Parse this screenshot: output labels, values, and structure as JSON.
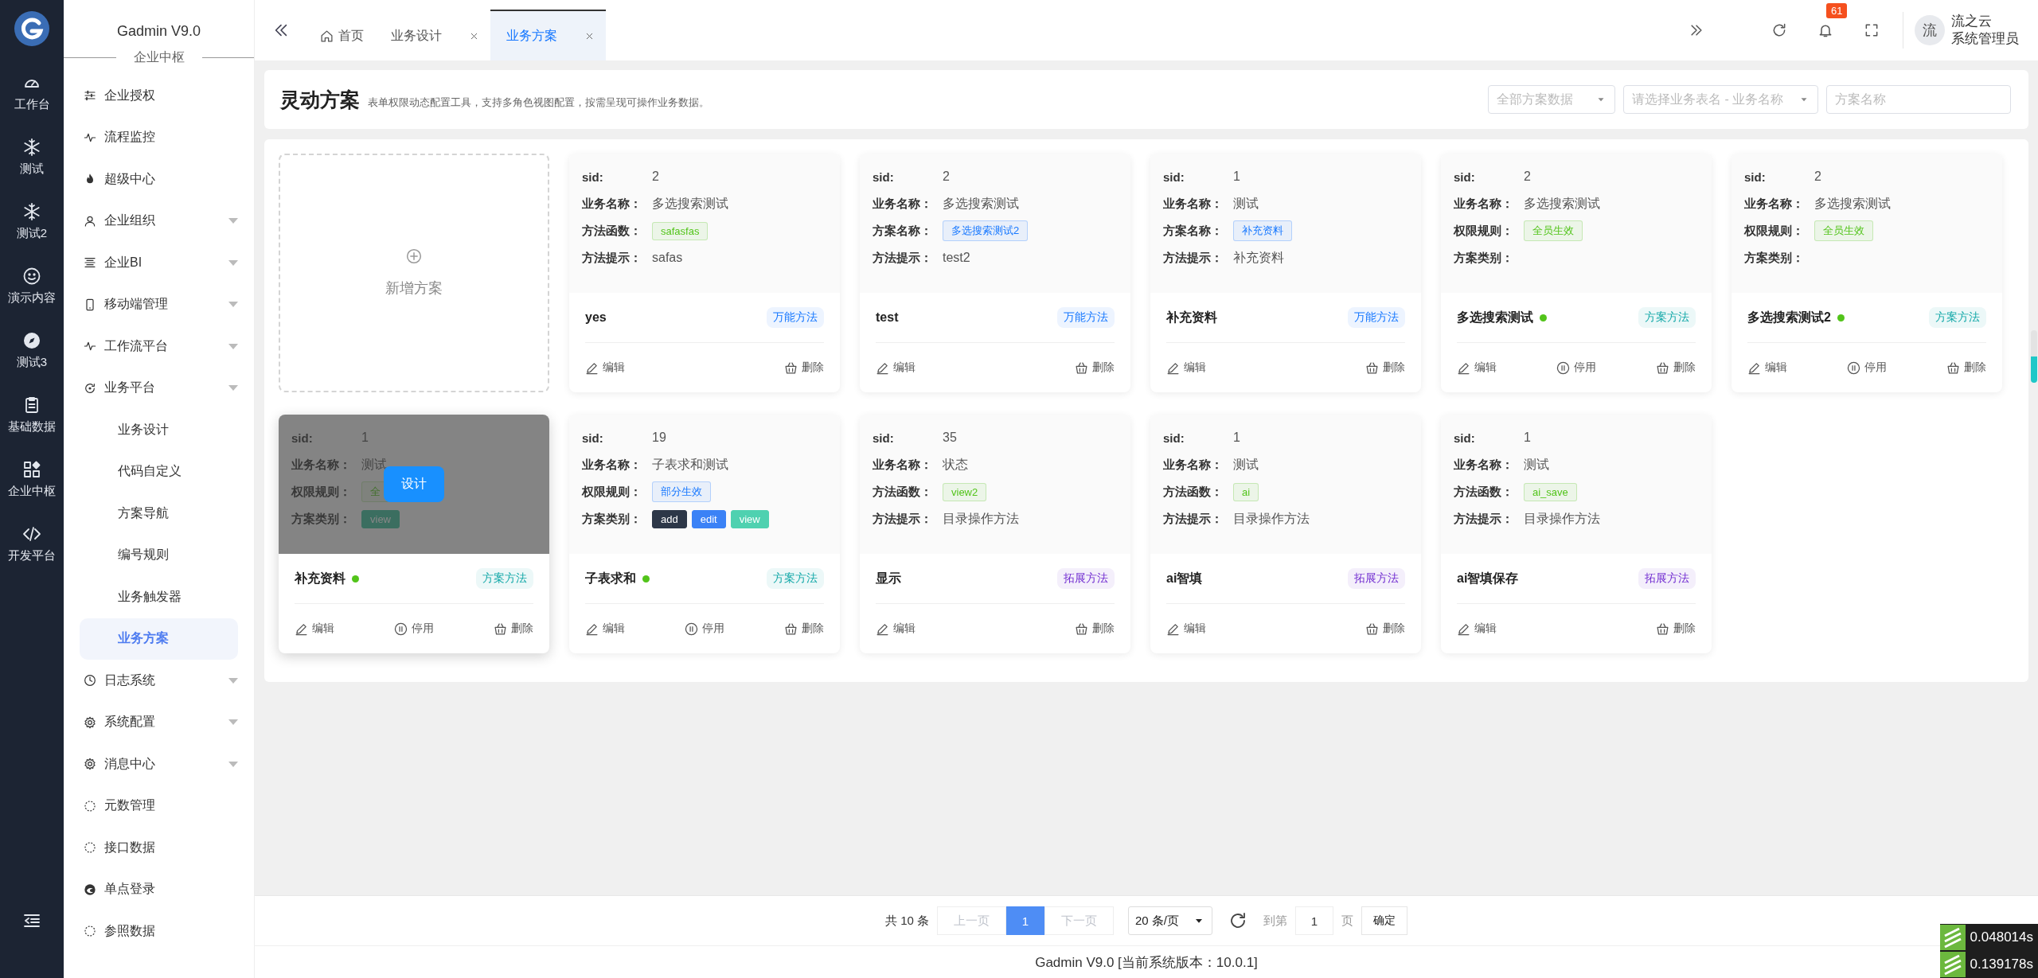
{
  "rail": {
    "items": [
      {
        "label": "工作台"
      },
      {
        "label": "测试"
      },
      {
        "label": "测试2"
      },
      {
        "label": "演示内容"
      },
      {
        "label": "测试3"
      },
      {
        "label": "基础数据"
      },
      {
        "label": "企业中枢"
      },
      {
        "label": "开发平台"
      }
    ]
  },
  "sidebar": {
    "title": "Gadmin V9.0",
    "section": "企业中枢",
    "items": [
      {
        "label": "企业授权",
        "collapsible": false
      },
      {
        "label": "流程监控",
        "collapsible": false
      },
      {
        "label": "超级中心",
        "collapsible": false
      },
      {
        "label": "企业组织",
        "collapsible": true
      },
      {
        "label": "企业BI",
        "collapsible": true
      },
      {
        "label": "移动端管理",
        "collapsible": true
      },
      {
        "label": "工作流平台",
        "collapsible": true
      },
      {
        "label": "业务平台",
        "collapsible": true,
        "expanded": true,
        "children": [
          {
            "label": "业务设计",
            "selected": false
          },
          {
            "label": "代码自定义",
            "selected": false
          },
          {
            "label": "方案导航",
            "selected": false
          },
          {
            "label": "编号规则",
            "selected": false
          },
          {
            "label": "业务触发器",
            "selected": false
          },
          {
            "label": "业务方案",
            "selected": true
          }
        ]
      },
      {
        "label": "日志系统",
        "collapsible": true
      },
      {
        "label": "系统配置",
        "collapsible": true
      },
      {
        "label": "消息中心",
        "collapsible": true
      },
      {
        "label": "元数管理",
        "collapsible": false
      },
      {
        "label": "接口数据",
        "collapsible": false
      },
      {
        "label": "单点登录",
        "collapsible": false
      },
      {
        "label": "参照数据",
        "collapsible": false
      }
    ]
  },
  "tabs": [
    {
      "label": "首页",
      "closable": false,
      "selected": false
    },
    {
      "label": "业务设计",
      "closable": true,
      "selected": false
    },
    {
      "label": "业务方案",
      "closable": true,
      "selected": true
    }
  ],
  "topbar": {
    "notifications": "61",
    "avatar": "流",
    "user_name": "流之云",
    "user_role": "系统管理员"
  },
  "page": {
    "title": "灵动方案",
    "subtitle": "表单权限动态配置工具，支持多角色视图配置，按需呈现可操作业务数据。",
    "filters": [
      {
        "kind": "select",
        "placeholder": "全部方案数据"
      },
      {
        "kind": "select",
        "placeholder": "请选择业务表名 - 业务名称"
      },
      {
        "kind": "input",
        "placeholder": "方案名称"
      }
    ]
  },
  "add_card": {
    "label": "新增方案"
  },
  "cards": [
    {
      "hovered": false,
      "fields": [
        {
          "label": "sid:",
          "kind": "text",
          "value": "2"
        },
        {
          "label": "业务名称：",
          "kind": "text",
          "value": "多选搜索测试"
        },
        {
          "label": "方法函数：",
          "kind": "tags",
          "tags": [
            {
              "text": "safasfas",
              "color": "#52c41a",
              "kind": "light"
            }
          ]
        },
        {
          "label": "方法提示：",
          "kind": "text",
          "value": "safas"
        }
      ],
      "name": "yes",
      "enabled": false,
      "type": {
        "text": "万能方法",
        "color": "#1677ff"
      },
      "actions": [
        {
          "label": "编辑",
          "kind": "edit"
        },
        {
          "label": "删除",
          "kind": "delete"
        }
      ]
    },
    {
      "hovered": false,
      "fields": [
        {
          "label": "sid:",
          "kind": "text",
          "value": "2"
        },
        {
          "label": "业务名称：",
          "kind": "text",
          "value": "多选搜索测试"
        },
        {
          "label": "方案名称：",
          "kind": "tags",
          "tags": [
            {
              "text": "多选搜索测试2",
              "color": "#1677ff",
              "kind": "light"
            }
          ]
        },
        {
          "label": "方法提示：",
          "kind": "text",
          "value": "test2"
        }
      ],
      "name": "test",
      "enabled": false,
      "type": {
        "text": "万能方法",
        "color": "#1677ff"
      },
      "actions": [
        {
          "label": "编辑",
          "kind": "edit"
        },
        {
          "label": "删除",
          "kind": "delete"
        }
      ]
    },
    {
      "hovered": false,
      "fields": [
        {
          "label": "sid:",
          "kind": "text",
          "value": "1"
        },
        {
          "label": "业务名称：",
          "kind": "text",
          "value": "测试"
        },
        {
          "label": "方案名称：",
          "kind": "tags",
          "tags": [
            {
              "text": "补充资料",
              "color": "#1677ff",
              "kind": "light"
            }
          ]
        },
        {
          "label": "方法提示：",
          "kind": "text",
          "value": "补充资料"
        }
      ],
      "name": "补充资料",
      "enabled": false,
      "type": {
        "text": "万能方法",
        "color": "#1677ff"
      },
      "actions": [
        {
          "label": "编辑",
          "kind": "edit"
        },
        {
          "label": "删除",
          "kind": "delete"
        }
      ]
    },
    {
      "hovered": false,
      "fields": [
        {
          "label": "sid:",
          "kind": "text",
          "value": "2"
        },
        {
          "label": "业务名称：",
          "kind": "text",
          "value": "多选搜索测试"
        },
        {
          "label": "权限规则：",
          "kind": "tags",
          "tags": [
            {
              "text": "全员生效",
              "color": "#52c41a",
              "kind": "light"
            }
          ]
        },
        {
          "label": "方案类别：",
          "kind": "blank"
        }
      ],
      "name": "多选搜索测试",
      "enabled": true,
      "type": {
        "text": "方案方法",
        "color": "#13a8a8"
      },
      "actions": [
        {
          "label": "编辑",
          "kind": "edit"
        },
        {
          "label": "停用",
          "kind": "pause"
        },
        {
          "label": "删除",
          "kind": "delete"
        }
      ]
    },
    {
      "hovered": false,
      "fields": [
        {
          "label": "sid:",
          "kind": "text",
          "value": "2"
        },
        {
          "label": "业务名称：",
          "kind": "text",
          "value": "多选搜索测试"
        },
        {
          "label": "权限规则：",
          "kind": "tags",
          "tags": [
            {
              "text": "全员生效",
              "color": "#52c41a",
              "kind": "light"
            }
          ]
        },
        {
          "label": "方案类别：",
          "kind": "blank"
        }
      ],
      "name": "多选搜索测试2",
      "enabled": true,
      "type": {
        "text": "方案方法",
        "color": "#13a8a8"
      },
      "actions": [
        {
          "label": "编辑",
          "kind": "edit"
        },
        {
          "label": "停用",
          "kind": "pause"
        },
        {
          "label": "删除",
          "kind": "delete"
        }
      ]
    },
    {
      "hovered": true,
      "overlay_button": "设计",
      "fields": [
        {
          "label": "sid:",
          "kind": "text",
          "value": "1"
        },
        {
          "label": "业务名称：",
          "kind": "text",
          "value": "测试"
        },
        {
          "label": "权限规则：",
          "kind": "tags",
          "tags": [
            {
              "text": "全",
              "kind": "light"
            }
          ]
        },
        {
          "label": "方案类别：",
          "kind": "tags",
          "tags": [
            {
              "text": "view",
              "kind": "solid"
            }
          ]
        }
      ],
      "name": "补充资料",
      "enabled": true,
      "type": {
        "text": "方案方法",
        "color": "#13a8a8"
      },
      "actions": [
        {
          "label": "编辑",
          "kind": "edit"
        },
        {
          "label": "停用",
          "kind": "pause"
        },
        {
          "label": "删除",
          "kind": "delete"
        }
      ]
    },
    {
      "hovered": false,
      "fields": [
        {
          "label": "sid:",
          "kind": "text",
          "value": "19"
        },
        {
          "label": "业务名称：",
          "kind": "text",
          "value": "子表求和测试"
        },
        {
          "label": "权限规则：",
          "kind": "tags",
          "tags": [
            {
              "text": "部分生效",
              "color": "#1677ff",
              "kind": "light"
            }
          ]
        },
        {
          "label": "方案类别：",
          "kind": "tags",
          "tags": [
            {
              "text": "add",
              "color": "#2d3748",
              "kind": "solid"
            },
            {
              "text": "edit",
              "color": "#3b82f6",
              "kind": "solid"
            },
            {
              "text": "view",
              "color": "#4fd1b0",
              "kind": "solid"
            }
          ]
        }
      ],
      "name": "子表求和",
      "enabled": true,
      "type": {
        "text": "方案方法",
        "color": "#13a8a8"
      },
      "actions": [
        {
          "label": "编辑",
          "kind": "edit"
        },
        {
          "label": "停用",
          "kind": "pause"
        },
        {
          "label": "删除",
          "kind": "delete"
        }
      ]
    },
    {
      "hovered": false,
      "fields": [
        {
          "label": "sid:",
          "kind": "text",
          "value": "35"
        },
        {
          "label": "业务名称：",
          "kind": "text",
          "value": "状态"
        },
        {
          "label": "方法函数：",
          "kind": "tags",
          "tags": [
            {
              "text": "view2",
              "color": "#52c41a",
              "kind": "light"
            }
          ]
        },
        {
          "label": "方法提示：",
          "kind": "text",
          "value": "目录操作方法"
        }
      ],
      "name": "显示",
      "enabled": false,
      "type": {
        "text": "拓展方法",
        "color": "#722ed1"
      },
      "actions": [
        {
          "label": "编辑",
          "kind": "edit"
        },
        {
          "label": "删除",
          "kind": "delete"
        }
      ]
    },
    {
      "hovered": false,
      "fields": [
        {
          "label": "sid:",
          "kind": "text",
          "value": "1"
        },
        {
          "label": "业务名称：",
          "kind": "text",
          "value": "测试"
        },
        {
          "label": "方法函数：",
          "kind": "tags",
          "tags": [
            {
              "text": "ai",
              "color": "#52c41a",
              "kind": "light"
            }
          ]
        },
        {
          "label": "方法提示：",
          "kind": "text",
          "value": "目录操作方法"
        }
      ],
      "name": "ai智填",
      "enabled": false,
      "type": {
        "text": "拓展方法",
        "color": "#722ed1"
      },
      "actions": [
        {
          "label": "编辑",
          "kind": "edit"
        },
        {
          "label": "删除",
          "kind": "delete"
        }
      ]
    },
    {
      "hovered": false,
      "fields": [
        {
          "label": "sid:",
          "kind": "text",
          "value": "1"
        },
        {
          "label": "业务名称：",
          "kind": "text",
          "value": "测试"
        },
        {
          "label": "方法函数：",
          "kind": "tags",
          "tags": [
            {
              "text": "ai_save",
              "color": "#52c41a",
              "kind": "light"
            }
          ]
        },
        {
          "label": "方法提示：",
          "kind": "text",
          "value": "目录操作方法"
        }
      ],
      "name": "ai智填保存",
      "enabled": false,
      "type": {
        "text": "拓展方法",
        "color": "#722ed1"
      },
      "actions": [
        {
          "label": "编辑",
          "kind": "edit"
        },
        {
          "label": "删除",
          "kind": "delete"
        }
      ]
    }
  ],
  "pagination": {
    "total": "共 10 条",
    "prev": "上一页",
    "pages": [
      {
        "label": "1",
        "selected": true
      }
    ],
    "next": "下一页",
    "page_size": "20 条/页",
    "goto_label": "到第",
    "goto_value": "1",
    "page_unit": "页",
    "confirm": "确定"
  },
  "footer": "Gadmin V9.0 [当前系统版本：10.0.1]",
  "timers": [
    "0.048014s",
    "0.139178s"
  ]
}
